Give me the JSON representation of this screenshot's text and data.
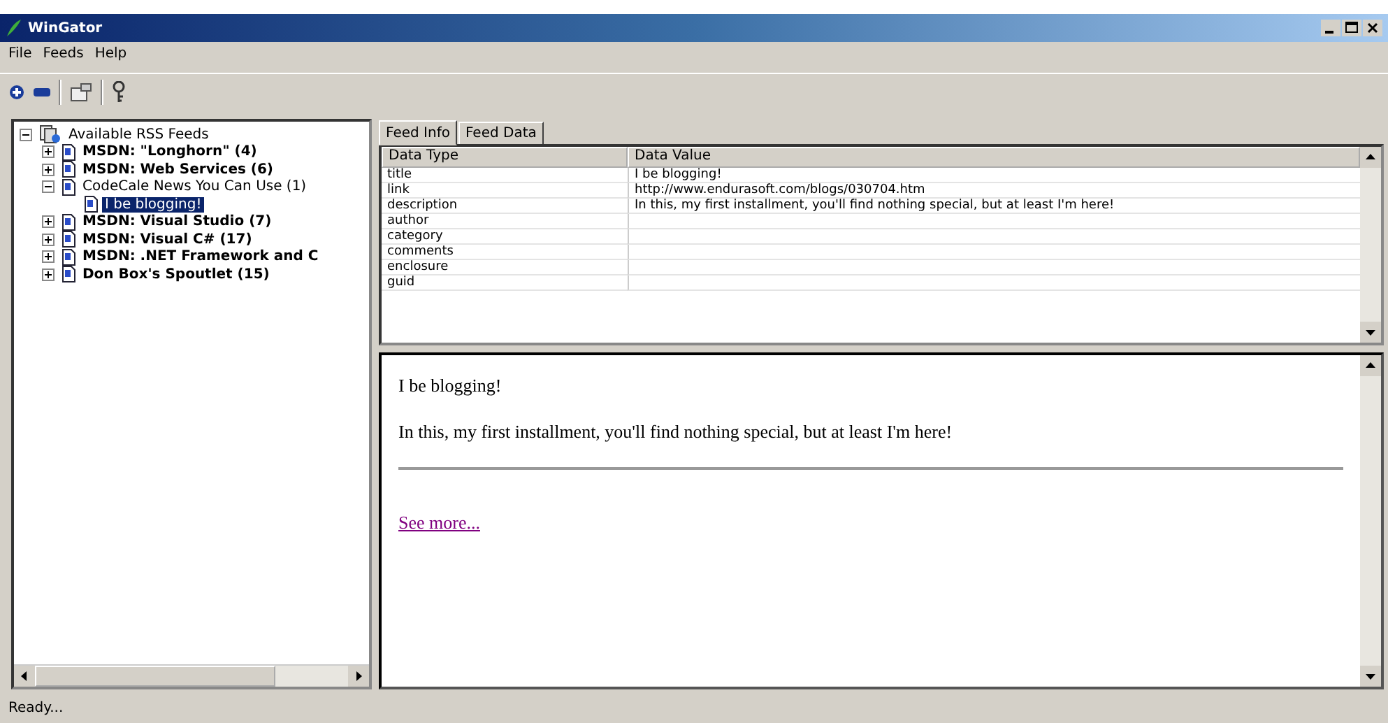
{
  "window": {
    "title": "WinGator"
  },
  "menu": [
    "File",
    "Feeds",
    "Help"
  ],
  "tree": {
    "label": "Available RSS Feeds",
    "expanded": true,
    "children": [
      {
        "label": "MSDN: \"Longhorn\"  (4)",
        "unread": true,
        "expanded": false,
        "selected": false
      },
      {
        "label": "MSDN: Web Services (6)",
        "unread": true,
        "expanded": false,
        "selected": false
      },
      {
        "label": "CodeCale News You Can Use (1)",
        "unread": false,
        "expanded": true,
        "selected": false,
        "children": [
          {
            "label": "I be blogging!",
            "unread": false,
            "selected": true
          }
        ]
      },
      {
        "label": "MSDN: Visual Studio (7)",
        "unread": true,
        "expanded": false,
        "selected": false
      },
      {
        "label": "MSDN: Visual C# (17)",
        "unread": true,
        "expanded": false,
        "selected": false
      },
      {
        "label": "MSDN: .NET Framework and C",
        "unread": true,
        "expanded": false,
        "selected": false
      },
      {
        "label": "Don Box's Spoutlet (15)",
        "unread": true,
        "expanded": false,
        "selected": false
      }
    ]
  },
  "tabs": [
    {
      "label": "Feed Info",
      "selected": true
    },
    {
      "label": "Feed Data",
      "selected": false
    }
  ],
  "table": {
    "columns": [
      "Data Type",
      "Data Value"
    ],
    "rows": [
      [
        "title",
        "I be blogging!"
      ],
      [
        "link",
        "http://www.endurasoft.com/blogs/030704.htm"
      ],
      [
        "description",
        "In this, my first installment, you'll find nothing special, but at least I'm here!"
      ],
      [
        "author",
        ""
      ],
      [
        "category",
        ""
      ],
      [
        "comments",
        ""
      ],
      [
        "enclosure",
        ""
      ],
      [
        "guid",
        ""
      ]
    ]
  },
  "preview": {
    "title": "I be blogging!",
    "body": "In this, my first installment, you'll find nothing special, but at least I'm here!",
    "link": "See more..."
  },
  "status_bar": "Ready..."
}
